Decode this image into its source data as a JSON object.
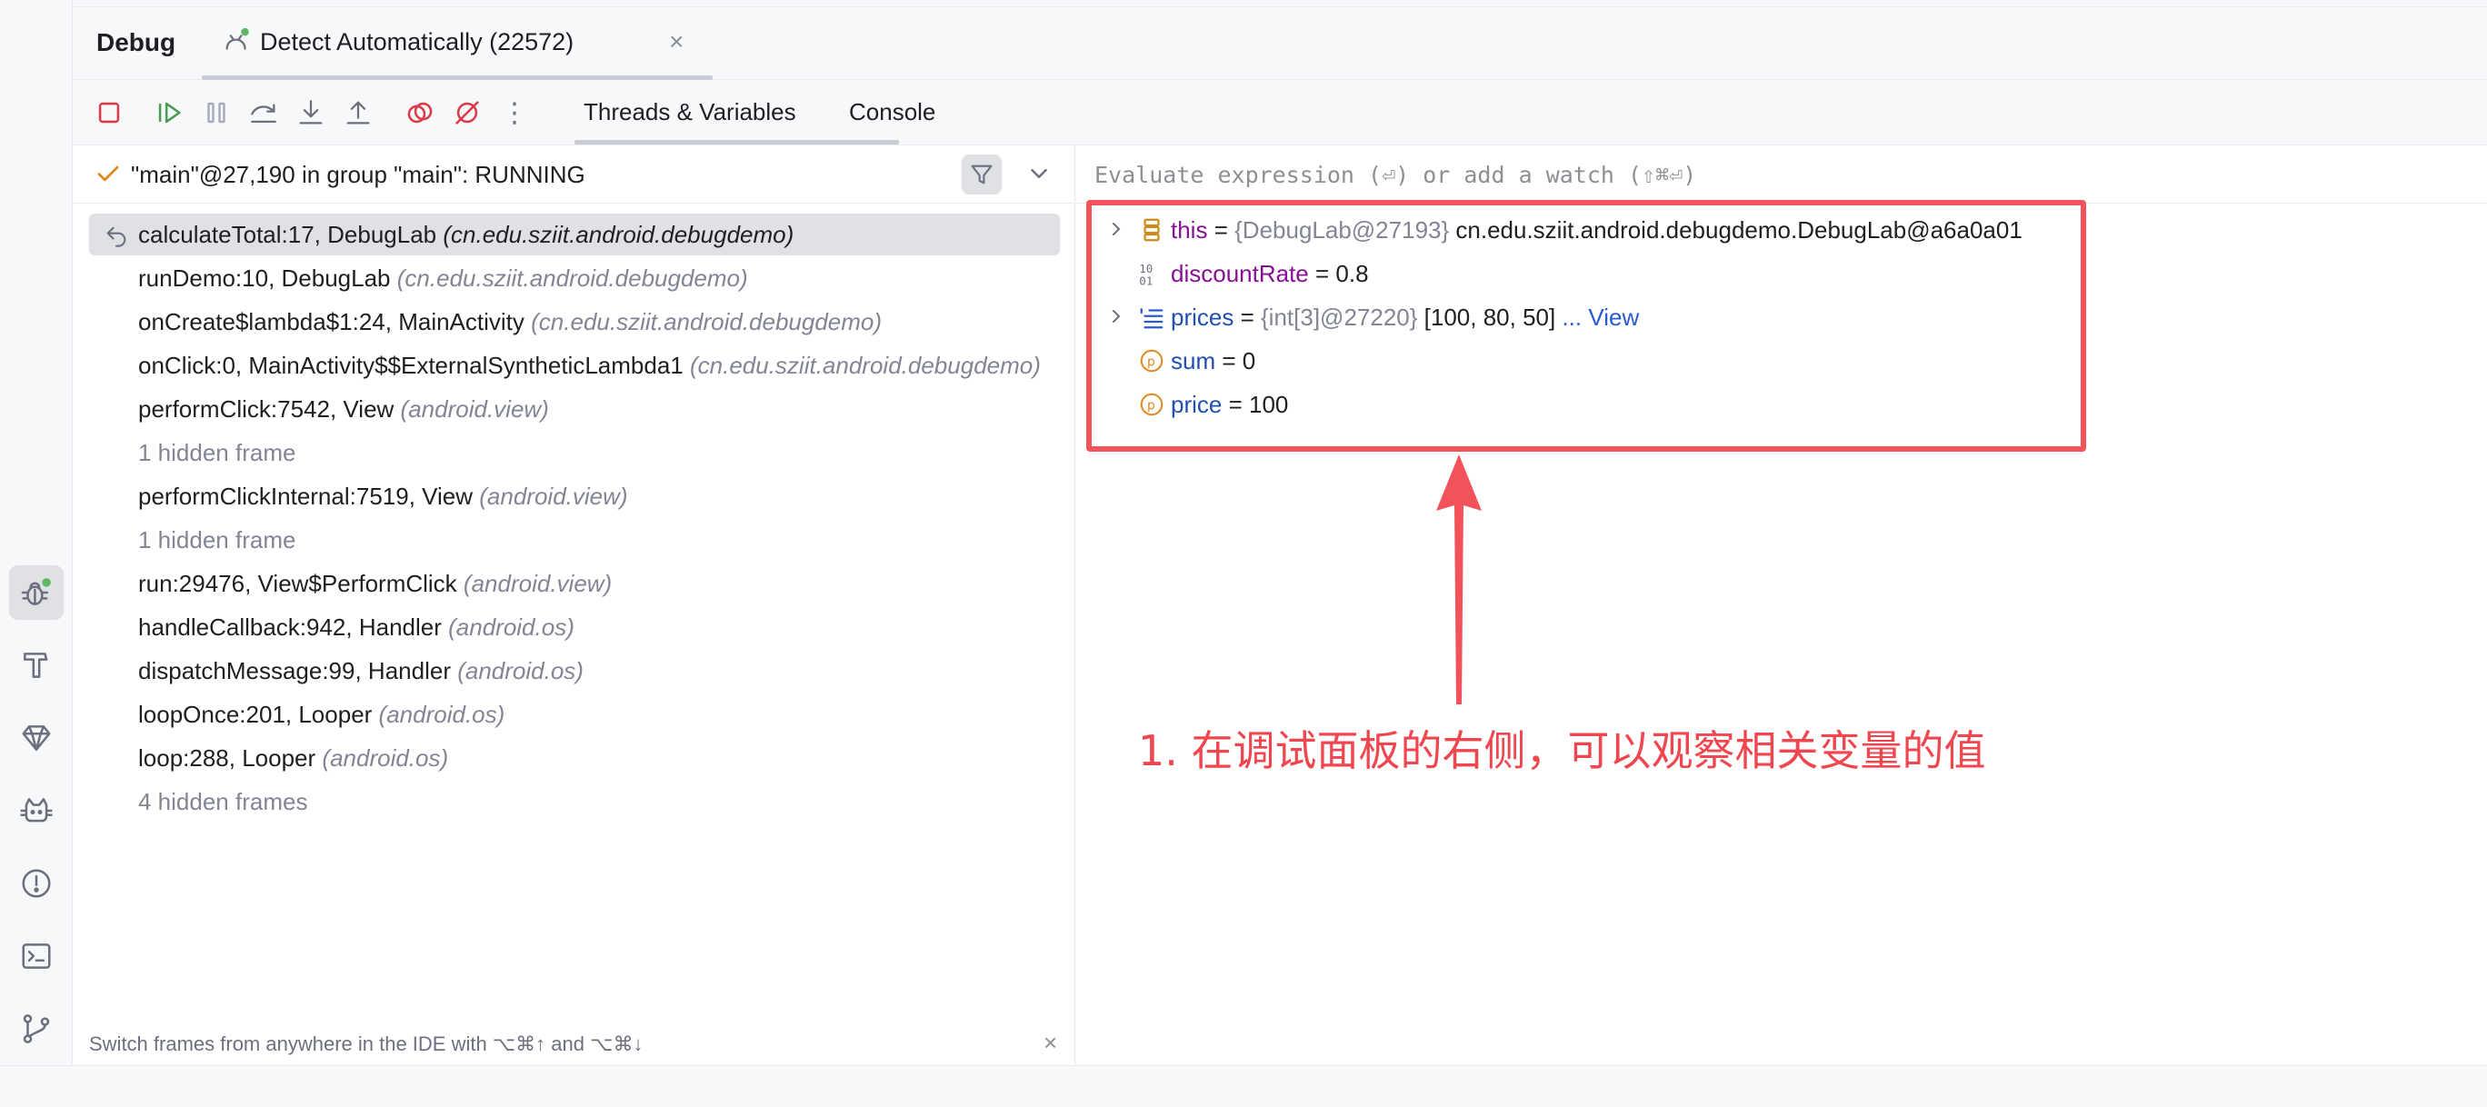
{
  "header": {
    "title": "Debug",
    "session_tab": "Detect Automatically (22572)",
    "close_glyph": "×"
  },
  "toolbar": {
    "tabs": [
      "Threads & Variables",
      "Console"
    ],
    "more_glyph": "⋮"
  },
  "thread": {
    "label": "\"main\"@27,190 in group \"main\": RUNNING"
  },
  "frames": [
    {
      "name": "calculateTotal:17, DebugLab",
      "pkg": "(cn.edu.sziit.android.debugdemo)",
      "selected": true
    },
    {
      "name": "runDemo:10, DebugLab",
      "pkg": "(cn.edu.sziit.android.debugdemo)"
    },
    {
      "name": "onCreate$lambda$1:24, MainActivity",
      "pkg": "(cn.edu.sziit.android.debugdemo)"
    },
    {
      "name": "onClick:0, MainActivity$$ExternalSyntheticLambda1",
      "pkg": "(cn.edu.sziit.android.debugdemo)"
    },
    {
      "name": "performClick:7542, View",
      "pkg": "(android.view)"
    },
    {
      "hidden": "1 hidden frame"
    },
    {
      "name": "performClickInternal:7519, View",
      "pkg": "(android.view)"
    },
    {
      "hidden": "1 hidden frame"
    },
    {
      "name": "run:29476, View$PerformClick",
      "pkg": "(android.view)"
    },
    {
      "name": "handleCallback:942, Handler",
      "pkg": "(android.os)"
    },
    {
      "name": "dispatchMessage:99, Handler",
      "pkg": "(android.os)"
    },
    {
      "name": "loopOnce:201, Looper",
      "pkg": "(android.os)"
    },
    {
      "name": "loop:288, Looper",
      "pkg": "(android.os)"
    },
    {
      "hidden": "4 hidden frames"
    }
  ],
  "frames_hint": "Switch frames from anywhere in the IDE with ⌥⌘↑ and ⌥⌘↓",
  "evaluate": {
    "placeholder": "Evaluate expression (⏎) or add a watch (⇧⌘⏎)"
  },
  "variables": {
    "this": {
      "name": "this",
      "eq": " = ",
      "type": "{DebugLab@27193}",
      "value": " cn.edu.sziit.android.debugdemo.DebugLab@a6a0a01"
    },
    "discountRate": {
      "name": "discountRate",
      "eq": " = ",
      "value": "0.8"
    },
    "prices": {
      "name": "prices",
      "eq": " = ",
      "type": "{int[3]@27220}",
      "value": " [100, 80, 50]",
      "link": " ... View"
    },
    "sum": {
      "name": "sum",
      "eq": " = ",
      "value": "0"
    },
    "price": {
      "name": "price",
      "eq": " = ",
      "value": "100"
    }
  },
  "annotation": {
    "text": "1. 在调试面板的右侧，可以观察相关变量的值",
    "color": "#f0464f"
  },
  "colors": {
    "accent_red": "#f2535a",
    "resume_green": "#499c54",
    "stop_red": "#db3b4b",
    "link_blue": "#2a5bd7"
  },
  "icons": {
    "stripe": [
      "debug-icon",
      "build-icon",
      "gem-icon",
      "cat-icon",
      "problems-icon",
      "terminal-icon",
      "git-branch-icon"
    ]
  }
}
